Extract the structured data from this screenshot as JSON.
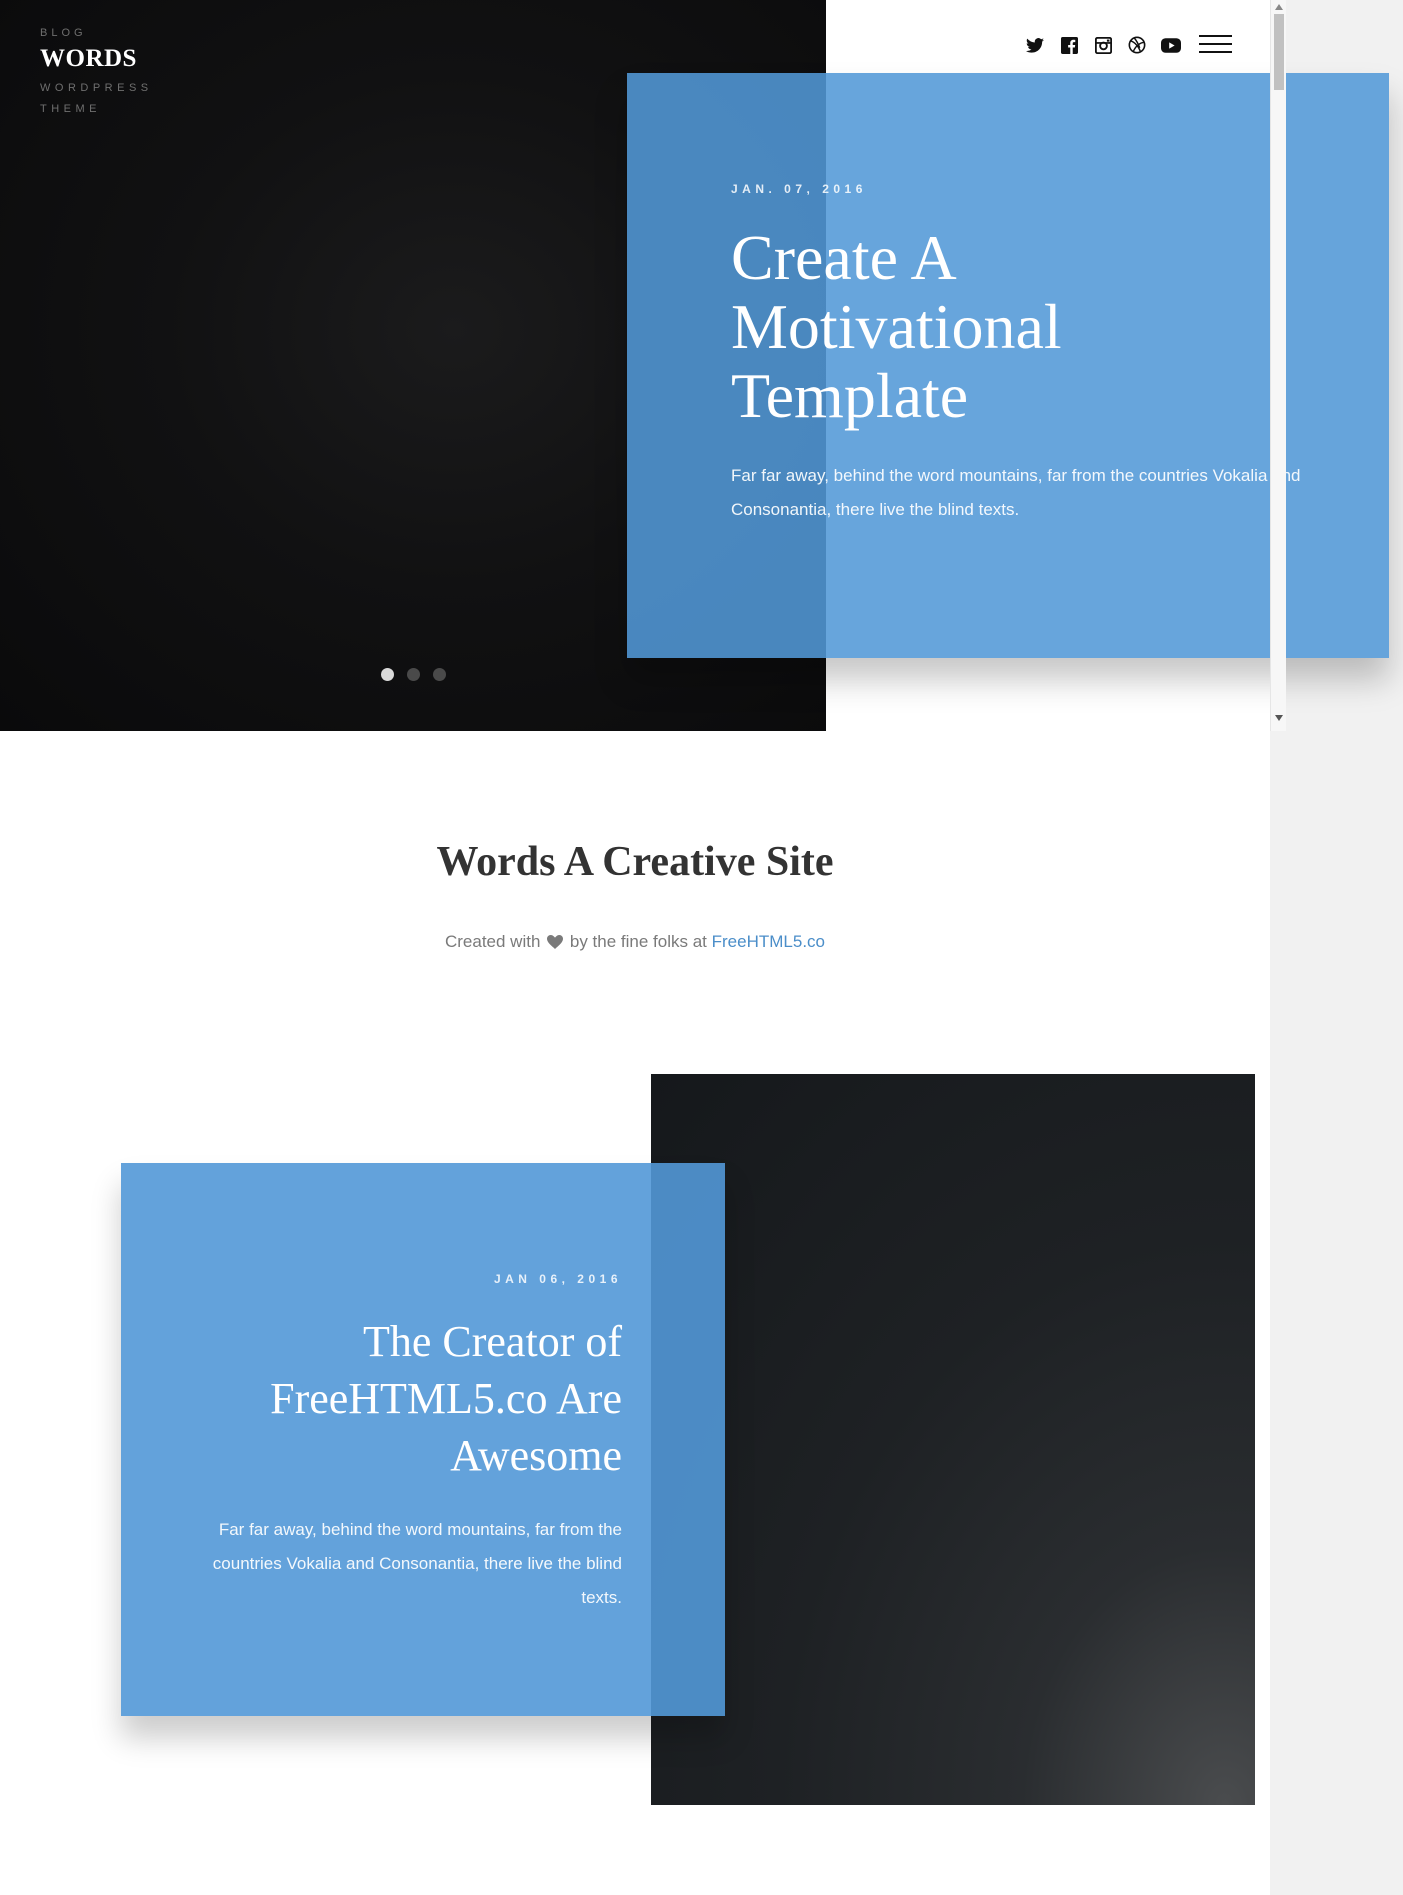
{
  "brand": {
    "kicker": "BLOG",
    "name": "WORDS",
    "tagline_line1": "WORDPRESS",
    "tagline_line2": "THEME"
  },
  "nav": {
    "social_icons": [
      "twitter-icon",
      "facebook-icon",
      "instagram-icon",
      "dribbble-icon",
      "youtube-icon"
    ],
    "menu_icon": "hamburger-icon"
  },
  "hero": {
    "date": "JAN. 07, 2016",
    "title": "Create A Motivational Template",
    "excerpt": "Far far away, behind the word mountains, far from the countries Vokalia and Consonantia, there live the blind texts.",
    "slides": {
      "count": 3,
      "active": 1
    }
  },
  "intro": {
    "title": "Words A Creative Site",
    "credit_before": "Created with",
    "credit_middle": "by the fine folks at",
    "credit_link": "FreeHTML5.co"
  },
  "post2": {
    "date": "JAN 06, 2016",
    "title": "The Creator of FreeHTML5.co Are Awesome",
    "excerpt": "Far far away, behind the word mountains, far from the countries Vokalia and Consonantia, there live the blind texts."
  },
  "colors": {
    "accent": "#5298d7",
    "link": "#4b8ec9",
    "dark": "#0f0f10"
  }
}
